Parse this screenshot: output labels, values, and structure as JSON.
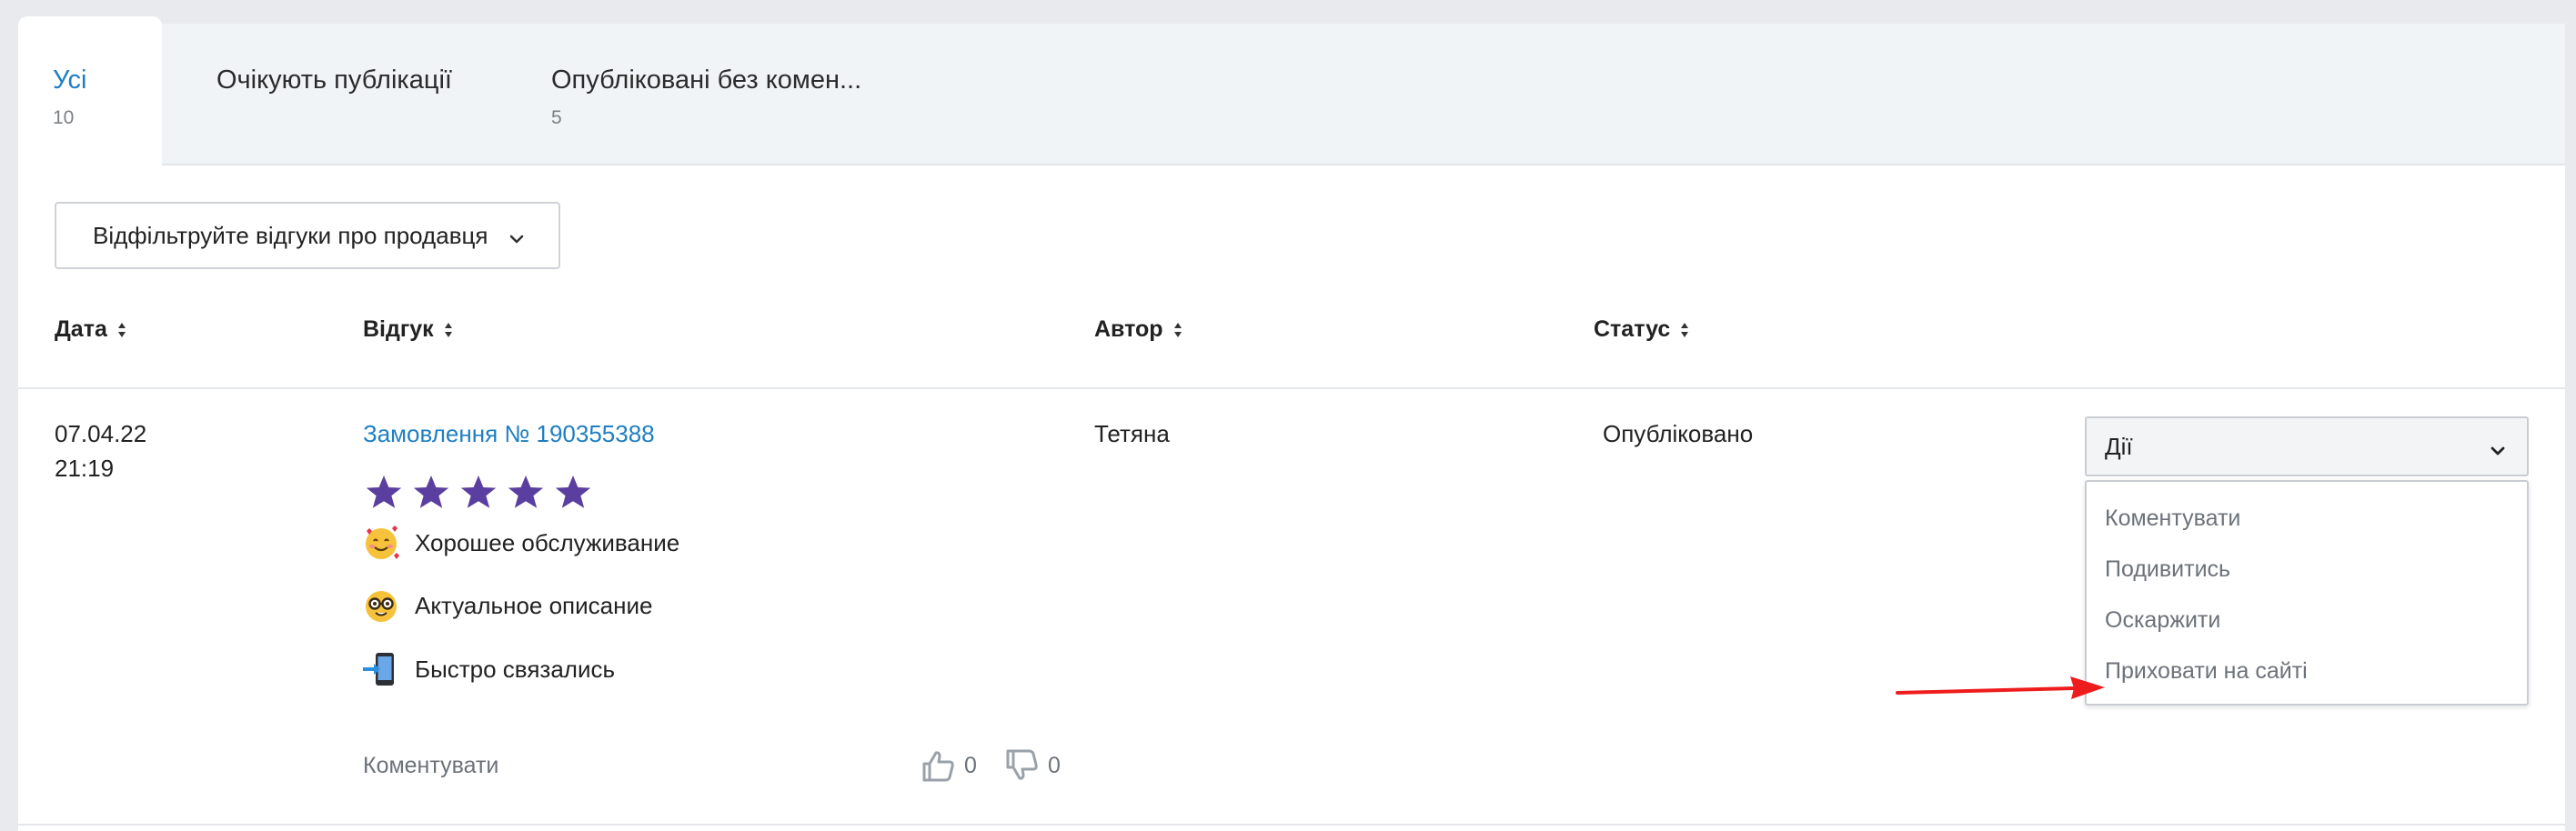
{
  "tabs": [
    {
      "label": "Усі",
      "count": "10"
    },
    {
      "label": "Очікують публікації",
      "count": ""
    },
    {
      "label": "Опубліковані без комен...",
      "count": "5"
    }
  ],
  "filter": {
    "label": "Відфільтруйте відгуки про продавця"
  },
  "table": {
    "headers": {
      "date": "Дата",
      "review": "Відгук",
      "author": "Автор",
      "status": "Статус"
    },
    "row": {
      "date": "07.04.22",
      "time": "21:19",
      "order_link": "Замовлення № 190355388",
      "rating": 5,
      "tags": [
        {
          "emoji": "smiling-face-with-hearts-icon",
          "text": "Хорошее обслуживание"
        },
        {
          "emoji": "nerd-face-icon",
          "text": "Актуальное описание"
        },
        {
          "emoji": "mobile-phone-arrow-icon",
          "text": "Быстро связались"
        }
      ],
      "comment_link": "Коментувати",
      "likes": "0",
      "dislikes": "0",
      "author": "Тетяна",
      "status": "Опубліковано"
    }
  },
  "actions": {
    "selected": "Дії",
    "options": [
      "Коментувати",
      "Подивитись",
      "Оскаржити",
      "Приховати на сайті"
    ]
  },
  "colors": {
    "accent_link": "#1f7fc2",
    "star": "#5b3fa0",
    "annotation_arrow": "#ee1c1c"
  }
}
